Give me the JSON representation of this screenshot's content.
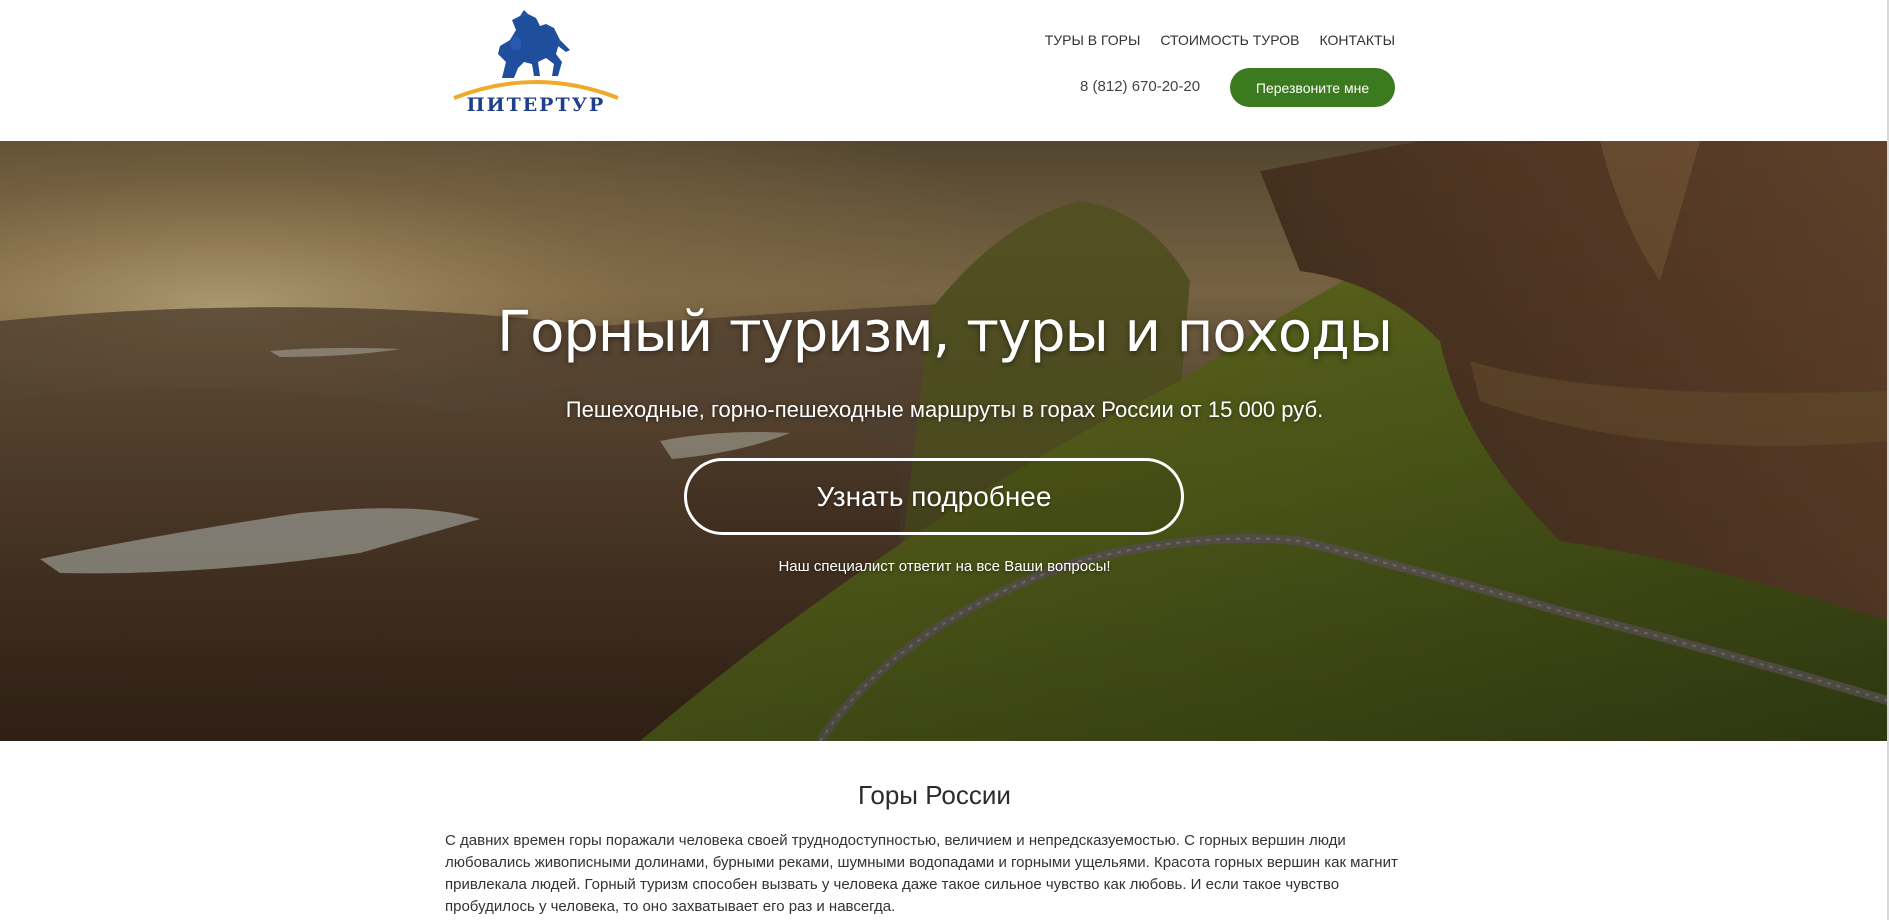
{
  "brand": {
    "name": "ПИТЕРТУР",
    "logo_icon": "horse-rider-icon",
    "colors": {
      "logo_blue": "#1f3f8c",
      "logo_arc": "#f0a92a"
    }
  },
  "nav": {
    "items": [
      {
        "label": "ТУРЫ В ГОРЫ"
      },
      {
        "label": "СТОИМОСТЬ ТУРОВ"
      },
      {
        "label": "КОНТАКТЫ"
      }
    ]
  },
  "contact": {
    "phone": "8 (812) 670-20-20",
    "callback_label": "Перезвоните мне",
    "callback_color": "#3c7a1f"
  },
  "hero": {
    "title": "Горный туризм, туры и походы",
    "subtitle": "Пешеходные, горно-пешеходные маршруты в горах России от 15 000 руб.",
    "button_label": "Узнать подробнее",
    "note": "Наш специалист ответит на все Ваши вопросы!"
  },
  "section": {
    "title": "Горы России",
    "text": "С давних времен горы поражали человека своей труднодоступностью, величием и непредсказуемостью. С горных вершин люди любовались живописными долинами, бурными реками, шумными водопадами и горными ущельями. Красота горных вершин как магнит привлекала людей. Горный туризм способен вызвать у человека даже такое сильное чувство как любовь. И если такое чувство пробудилось у человека, то оно захватывает его раз и навсегда."
  }
}
